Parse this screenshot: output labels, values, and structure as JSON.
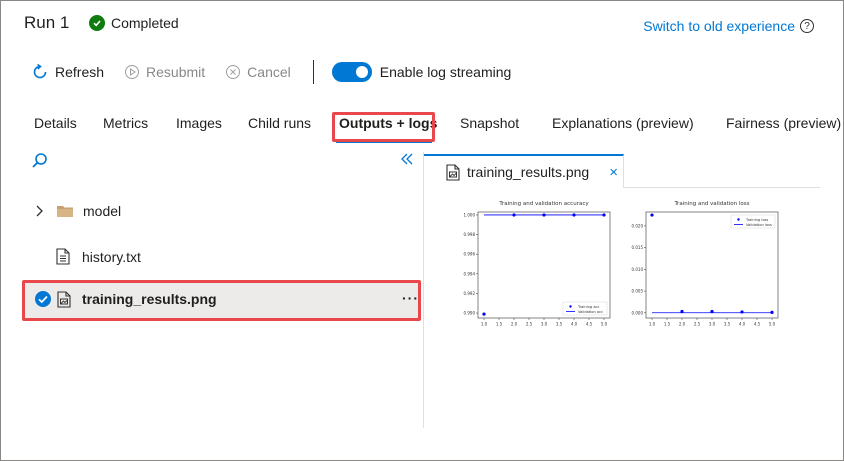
{
  "header": {
    "title": "Run 1",
    "status": "Completed",
    "status_color": "#107c10",
    "switch_link": "Switch to old experience",
    "help_icon": "?"
  },
  "toolbar": {
    "refresh": "Refresh",
    "resubmit": "Resubmit",
    "cancel": "Cancel",
    "log_streaming": "Enable log streaming",
    "log_streaming_on": true
  },
  "tabs": [
    {
      "label": "Details"
    },
    {
      "label": "Metrics"
    },
    {
      "label": "Images"
    },
    {
      "label": "Child runs"
    },
    {
      "label": "Outputs + logs",
      "active": true
    },
    {
      "label": "Snapshot"
    },
    {
      "label": "Explanations (preview)"
    },
    {
      "label": "Fairness (preview)"
    }
  ],
  "file_tree": {
    "items": [
      {
        "name": "model",
        "type": "folder"
      },
      {
        "name": "history.txt",
        "type": "file"
      },
      {
        "name": "training_results.png",
        "type": "image",
        "selected": true
      }
    ],
    "more": "···"
  },
  "preview": {
    "tab_label": "training_results.png",
    "close_glyph": "×"
  },
  "accent_color": "#0078d4",
  "highlight_color": "#e8474c",
  "chart_data": [
    {
      "type": "line",
      "title": "Training and validation accuracy",
      "x": [
        1,
        2,
        3,
        4,
        5
      ],
      "xticks": [
        "1.0",
        "1.5",
        "2.0",
        "2.5",
        "3.0",
        "3.5",
        "4.0",
        "4.5",
        "5.0"
      ],
      "yticks": [
        "0.990",
        "0.992",
        "0.994",
        "0.996",
        "0.998",
        "1.000"
      ],
      "ylim": [
        0.9895,
        1.0003
      ],
      "series": [
        {
          "name": "Training acc",
          "style": "points",
          "values": [
            0.9899,
            1.0,
            1.0,
            1.0,
            1.0
          ]
        },
        {
          "name": "Validation acc",
          "style": "line",
          "values": [
            1.0,
            1.0,
            1.0,
            1.0,
            1.0
          ]
        }
      ],
      "legend": "bottom-right"
    },
    {
      "type": "line",
      "title": "Training and validation loss",
      "x": [
        1,
        2,
        3,
        4,
        5
      ],
      "xticks": [
        "1.0",
        "1.5",
        "2.0",
        "2.5",
        "3.0",
        "3.5",
        "4.0",
        "4.5",
        "5.0"
      ],
      "yticks": [
        "0.000",
        "0.005",
        "0.010",
        "0.015",
        "0.020"
      ],
      "ylim": [
        -0.0012,
        0.0232
      ],
      "series": [
        {
          "name": "Training loss",
          "style": "points",
          "values": [
            0.0225,
            0.0003,
            0.0003,
            0.0002,
            0.0001
          ]
        },
        {
          "name": "Validation loss",
          "style": "line",
          "values": [
            0.0,
            0.0,
            0.0,
            0.0,
            0.0
          ]
        }
      ],
      "legend": "top-right"
    }
  ]
}
